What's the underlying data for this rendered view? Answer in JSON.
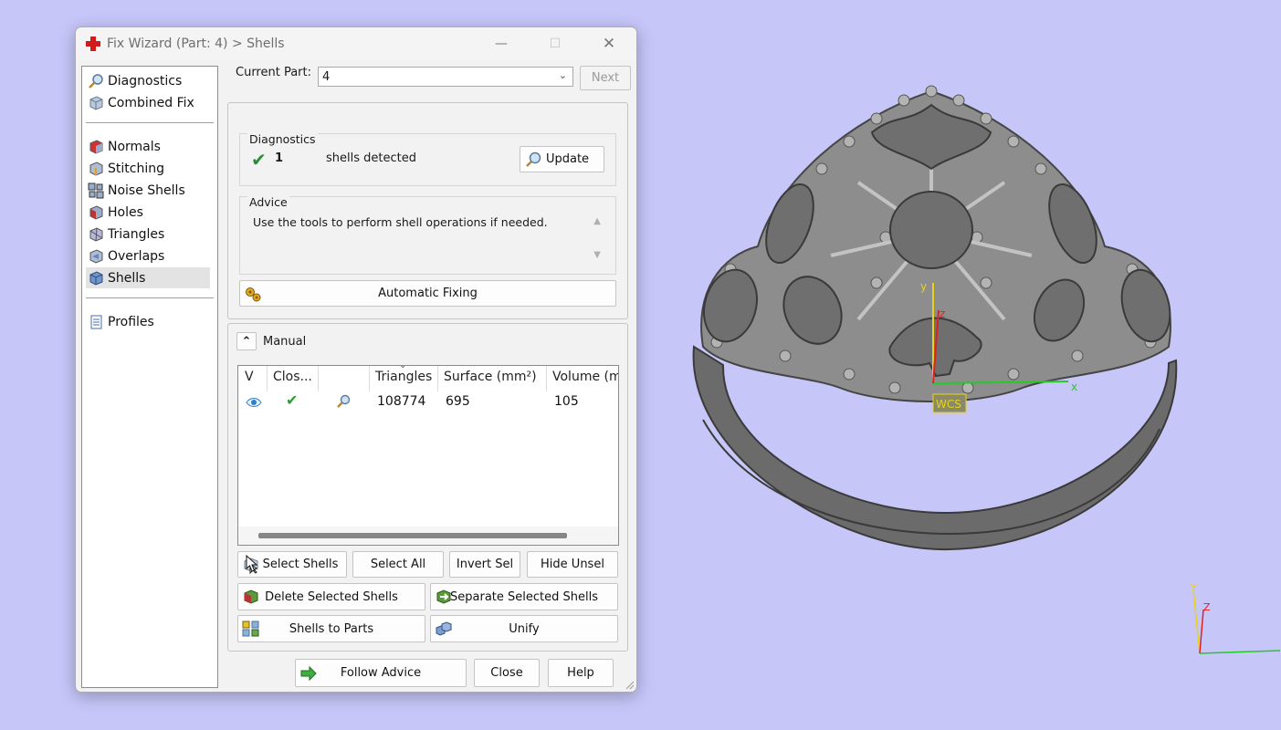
{
  "window": {
    "title": "Fix Wizard (Part: 4) > Shells",
    "minimize": "—",
    "maximize": "☐",
    "close": "✕"
  },
  "nav": {
    "items": [
      {
        "label": "Diagnostics",
        "icon": "magnifier-icon"
      },
      {
        "label": "Combined Fix",
        "icon": "cube-icon"
      },
      {
        "label": "Normals",
        "icon": "normals-cube-icon"
      },
      {
        "label": "Stitching",
        "icon": "stitching-cube-icon"
      },
      {
        "label": "Noise Shells",
        "icon": "noise-shells-icon"
      },
      {
        "label": "Holes",
        "icon": "holes-cube-icon"
      },
      {
        "label": "Triangles",
        "icon": "triangles-cube-icon"
      },
      {
        "label": "Overlaps",
        "icon": "overlaps-cube-icon"
      },
      {
        "label": "Shells",
        "icon": "shells-cube-icon",
        "selected": true
      },
      {
        "label": "Profiles",
        "icon": "document-icon"
      }
    ]
  },
  "current_part": {
    "label": "Current Part:",
    "value": "4",
    "next_label": "Next"
  },
  "diagnostics": {
    "title": "Diagnostics",
    "count": "1",
    "text": "shells detected",
    "update_label": "Update"
  },
  "advice": {
    "title": "Advice",
    "text": "Use the tools to perform shell operations if needed."
  },
  "automatic_fixing_label": "Automatic Fixing",
  "manual": {
    "collapse_glyph": "⌃",
    "label": "Manual",
    "table": {
      "columns": [
        "V",
        "Clos...",
        "",
        "Triangles",
        "Surface (mm²)",
        "Volume (m"
      ],
      "rows": [
        {
          "triangles": "108774",
          "surface": "695",
          "volume": "105"
        }
      ]
    },
    "buttons": {
      "select_shells": "Select Shells",
      "select_all": "Select All",
      "invert_sel": "Invert Sel",
      "hide_unsel": "Hide Unsel",
      "delete_selected": "Delete Selected Shells",
      "separate_selected": "Separate Selected Shells",
      "shells_to_parts": "Shells to Parts",
      "unify": "Unify"
    }
  },
  "footer": {
    "follow_advice": "Follow Advice",
    "close": "Close",
    "help": "Help"
  },
  "viewport": {
    "wcs_label": "WCS",
    "axis_x": "x",
    "axis_y": "y",
    "axis_z": "z",
    "triad_z": "Z",
    "triad_y": "Y"
  },
  "colors": {
    "background": "#c6c6f9",
    "model": "#7a7a7a",
    "axis_x": "#22cc22",
    "axis_y": "#e8d21a",
    "axis_z": "#e02020"
  }
}
